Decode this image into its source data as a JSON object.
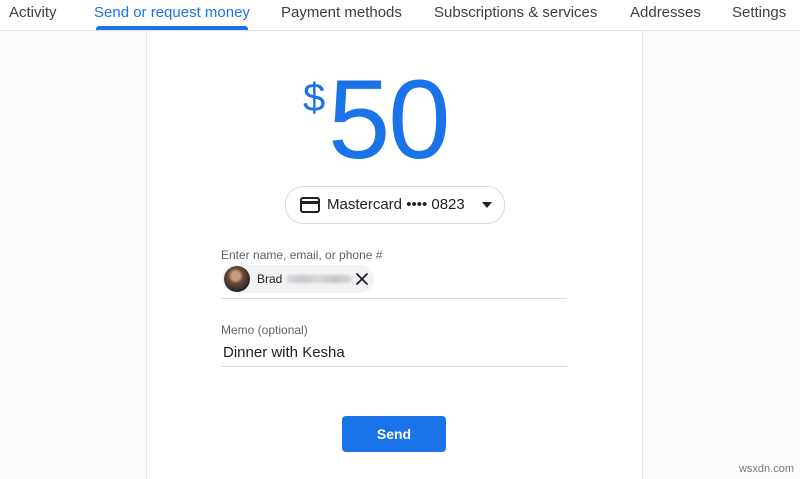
{
  "tabs": [
    {
      "label": "Activity",
      "active": false
    },
    {
      "label": "Send or request money",
      "active": true
    },
    {
      "label": "Payment methods",
      "active": false
    },
    {
      "label": "Subscriptions & services",
      "active": false
    },
    {
      "label": "Addresses",
      "active": false
    },
    {
      "label": "Settings",
      "active": false
    }
  ],
  "amount": {
    "currency_symbol": "$",
    "value": "50"
  },
  "payment_method": {
    "label": "Mastercard •••• 0823",
    "icon": "credit-card-icon"
  },
  "recipient": {
    "label": "Enter name, email, or phone #",
    "chip_name": "Brad",
    "remove_icon": "close-icon"
  },
  "memo": {
    "label": "Memo (optional)",
    "value": "Dinner with Kesha"
  },
  "send_button": {
    "label": "Send"
  },
  "watermark": "wsxdn.com",
  "colors": {
    "accent": "#1a73e8",
    "text": "#202124",
    "muted": "#5f6368"
  }
}
